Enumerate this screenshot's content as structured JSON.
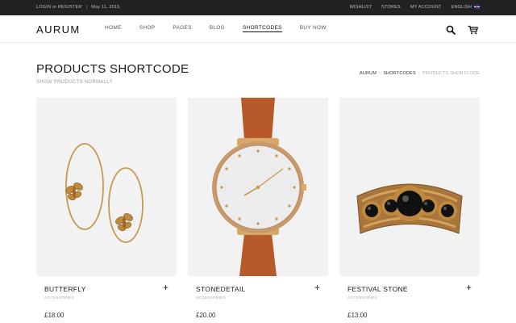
{
  "topbar": {
    "login": "LOGIN or REGISTER",
    "date": "May 11, 2015",
    "wishlist": "WISHLIST",
    "stores": "STORES",
    "account": "MY ACCOUNT",
    "language": "ENGLISH",
    "flag_icon": "uk-flag-icon"
  },
  "header": {
    "logo": "AURUM",
    "nav": [
      {
        "label": "HOME"
      },
      {
        "label": "SHOP"
      },
      {
        "label": "PAGES"
      },
      {
        "label": "BLOG"
      },
      {
        "label": "SHORTCODES"
      },
      {
        "label": "BUY NOW"
      }
    ],
    "active_nav": "SHORTCODES",
    "icons": [
      "search-icon",
      "cart-icon"
    ]
  },
  "page": {
    "title": "PRODUCTS SHORTCODE",
    "subtitle": "SHOW PRODUCTS NORMALLY",
    "breadcrumb": [
      "AURUM",
      "SHORTCODES",
      "PRODUCTS SHORTCODE"
    ]
  },
  "products": [
    {
      "name": "BUTTERFLY",
      "category": "ACCESSORIES",
      "price": "£18.00",
      "image": "butterfly-earrings"
    },
    {
      "name": "STONEDETAIL",
      "category": "ACCESSORIES",
      "price": "£20.00",
      "image": "leather-watch"
    },
    {
      "name": "FESTIVAL STONE",
      "category": "ACCESSORIES",
      "price": "£13.00",
      "image": "jeweled-cuff-bracelet"
    }
  ],
  "colors": {
    "topbar_bg": "#222222",
    "image_bg": "#f2f2f2",
    "gold": "#c9994f",
    "leather": "#b65a2a"
  }
}
